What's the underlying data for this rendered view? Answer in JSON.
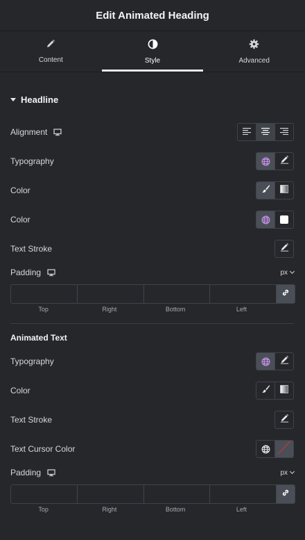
{
  "header": {
    "title": "Edit Animated Heading"
  },
  "tabs": [
    {
      "label": "Content",
      "icon": "pencil-icon"
    },
    {
      "label": "Style",
      "icon": "half-circle-icon",
      "active": true
    },
    {
      "label": "Advanced",
      "icon": "gear-icon"
    }
  ],
  "headline": {
    "title": "Headline",
    "alignment_label": "Alignment",
    "typography_label": "Typography",
    "color1_label": "Color",
    "color2_label": "Color",
    "text_stroke_label": "Text Stroke",
    "padding_label": "Padding",
    "padding_unit": "px",
    "padding_fields": [
      "Top",
      "Right",
      "Bottom",
      "Left"
    ]
  },
  "animated_text": {
    "title": "Animated Text",
    "typography_label": "Typography",
    "color_label": "Color",
    "text_stroke_label": "Text Stroke",
    "cursor_color_label": "Text Cursor Color",
    "padding_label": "Padding",
    "padding_unit": "px",
    "padding_fields": [
      "Top",
      "Right",
      "Bottom",
      "Left"
    ]
  },
  "colors": {
    "background": "#26272b",
    "border": "#3f444b",
    "globe_accent": "#c58fe8",
    "cursor_slash": "#d0303a"
  }
}
